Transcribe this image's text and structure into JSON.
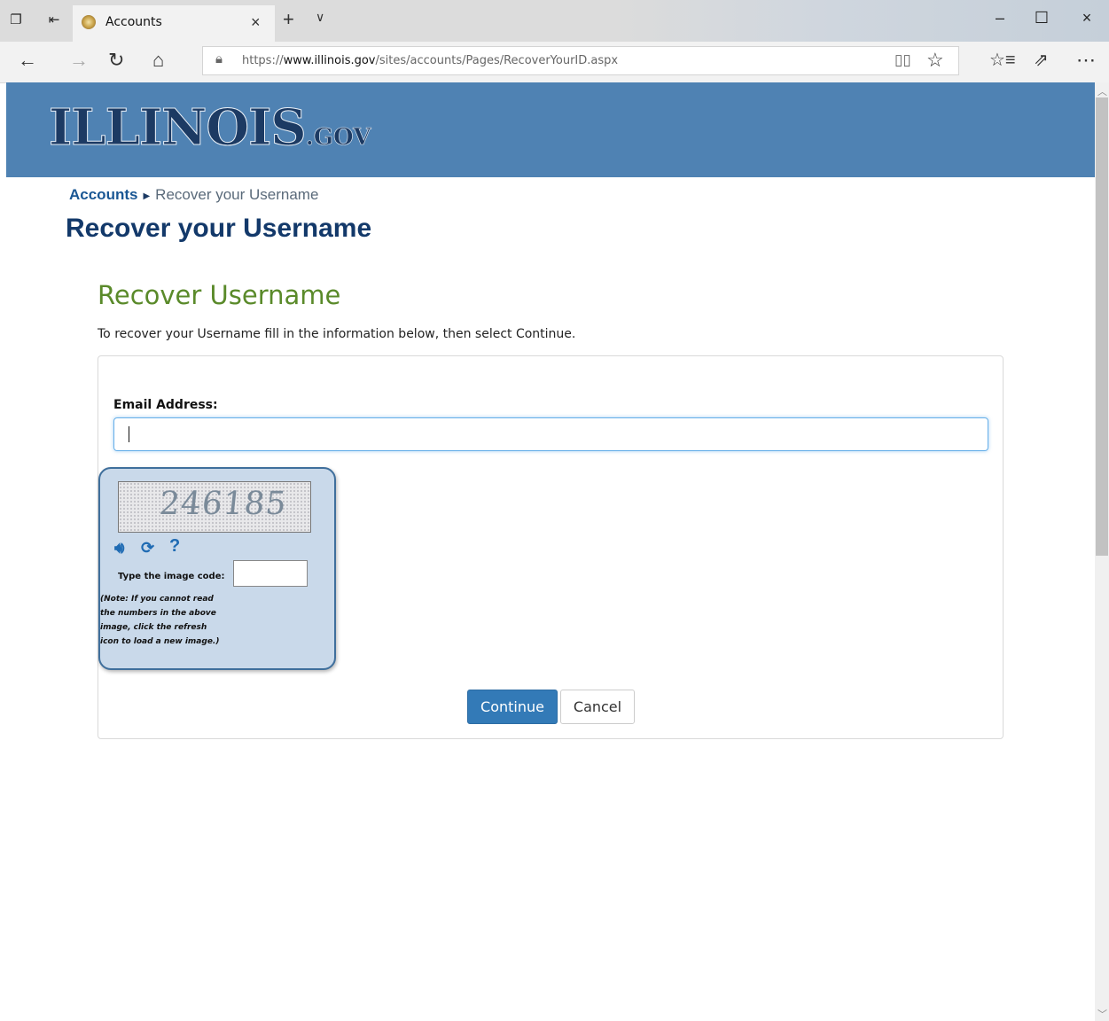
{
  "browser": {
    "tab": {
      "title": "Accounts",
      "close": "×"
    },
    "new_tab": "+",
    "tab_list": "∨",
    "window": {
      "minimize": "–",
      "maximize": "☐",
      "close": "×"
    },
    "url_prefix": "https://",
    "url_host": "www.illinois.gov",
    "url_path": "/sites/accounts/Pages/RecoverYourID.aspx"
  },
  "site": {
    "logo_main": "ILLINOIS",
    "logo_suffix": ".GOV",
    "banner_color": "#4f82b3"
  },
  "breadcrumb": {
    "home": "Accounts",
    "current": "Recover your Username"
  },
  "page_title": "Recover your Username",
  "form": {
    "section_title": "Recover Username",
    "description": "To recover your Username fill in the information below, then select Continue.",
    "email_label": "Email Address:",
    "email_value": "",
    "captcha": {
      "code": "246185",
      "label": "Type the image code:",
      "note": "(Note: If you cannot read the numbers in the above image, click the refresh icon to load a new image.)",
      "help": "?"
    },
    "continue_label": "Continue",
    "cancel_label": "Cancel",
    "accent_color": "#337ab7"
  }
}
